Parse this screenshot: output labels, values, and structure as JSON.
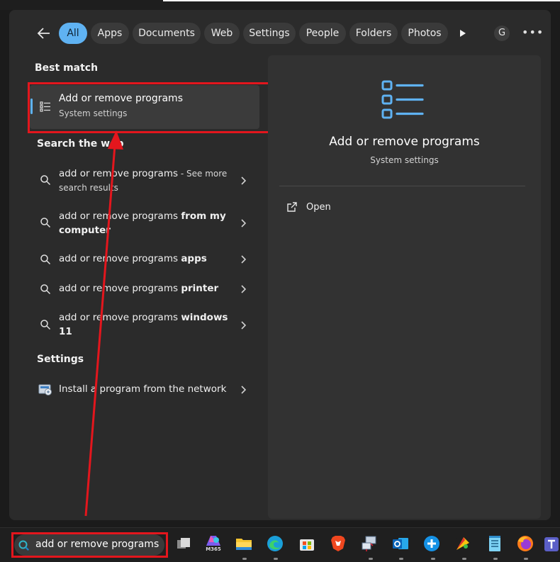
{
  "tabs": [
    "All",
    "Apps",
    "Documents",
    "Web",
    "Settings",
    "People",
    "Folders",
    "Photos"
  ],
  "avatar_letter": "G",
  "more_label": "•••",
  "sections": {
    "best_match": "Best match",
    "search_web": "Search the web",
    "settings": "Settings"
  },
  "best_match": {
    "title": "Add or remove programs",
    "subtitle": "System settings"
  },
  "web_results": [
    {
      "base": "add or remove programs",
      "bold": "",
      "suffix": " - See more",
      "line2": "search results"
    },
    {
      "base": "add or remove programs ",
      "bold": "from my",
      "suffix": "",
      "line2": "computer"
    },
    {
      "base": "add or remove programs ",
      "bold": "apps",
      "suffix": "",
      "line2": ""
    },
    {
      "base": "add or remove programs ",
      "bold": "printer",
      "suffix": "",
      "line2": ""
    },
    {
      "base": "add or remove programs ",
      "bold": "windows",
      "suffix": "",
      "line2": "11"
    }
  ],
  "settings_result": "Install a program from the network",
  "detail": {
    "title": "Add or remove programs",
    "subtitle": "System settings",
    "action_open": "Open"
  },
  "taskbar": {
    "search_query": "add or remove programs",
    "m365_label": "M365",
    "icons": [
      "task-view-icon",
      "m365-copilot-icon",
      "file-explorer-icon",
      "edge-icon",
      "store-icon",
      "brave-icon",
      "network-app-icon",
      "outlook-icon",
      "plus-app-icon",
      "paint-app-icon",
      "notepad-icon",
      "firefox-icon",
      "teams-icon"
    ]
  },
  "colors": {
    "accent": "#5fb2f2",
    "annotation_red": "#e3161d"
  }
}
